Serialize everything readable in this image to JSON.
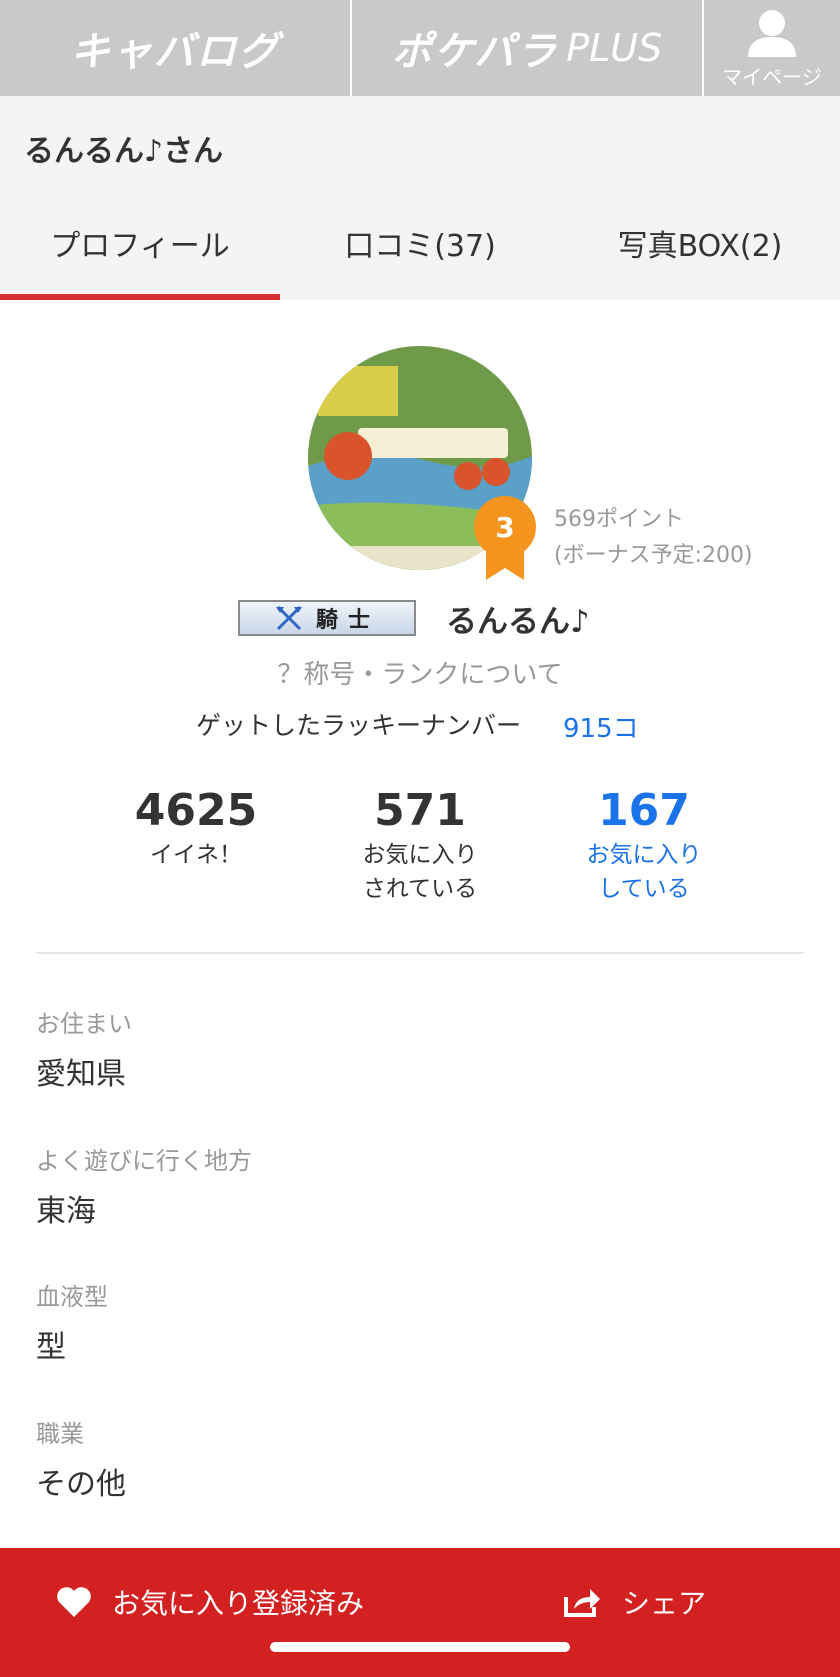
{
  "topnav": {
    "kyabalog_logo": "キャバログ",
    "pokepara_logo": "ポケパラ",
    "pokepara_plus": "PLUS",
    "mypage_label": "マイページ"
  },
  "header": {
    "title": "るんるん♪さん"
  },
  "tabs": [
    {
      "label": "プロフィール",
      "active": true
    },
    {
      "label": "口コミ(37)",
      "active": false
    },
    {
      "label": "写真BOX(2)",
      "active": false
    }
  ],
  "profile": {
    "rank": "3",
    "points": "569ポイント",
    "bonus": "(ボーナス予定:200)",
    "title_plate": "騎士",
    "username": "るんるん♪",
    "rank_link": "？称号・ランクについて",
    "lucky_label": "ゲットしたラッキーナンバー",
    "lucky_count": "915コ"
  },
  "stats": {
    "likes": {
      "num": "4625",
      "line1": "イイネ！",
      "line2": ""
    },
    "favorited": {
      "num": "571",
      "line1": "お気に入り",
      "line2": "されている"
    },
    "favoriting": {
      "num": "167",
      "line1": "お気に入り",
      "line2": "している"
    }
  },
  "fields": [
    {
      "label": "お住まい",
      "value": "愛知県"
    },
    {
      "label": "よく遊びに行く地方",
      "value": "東海"
    },
    {
      "label": "血液型",
      "value": "型"
    },
    {
      "label": "職業",
      "value": "その他"
    }
  ],
  "bottom": {
    "favorite_label": "お気に入り登録済み",
    "share_label": "シェア"
  },
  "colors": {
    "accent_red": "#d32121",
    "link_blue": "#1a73e8",
    "badge_orange": "#f5941e",
    "nav_gray": "#c9c9c9"
  }
}
